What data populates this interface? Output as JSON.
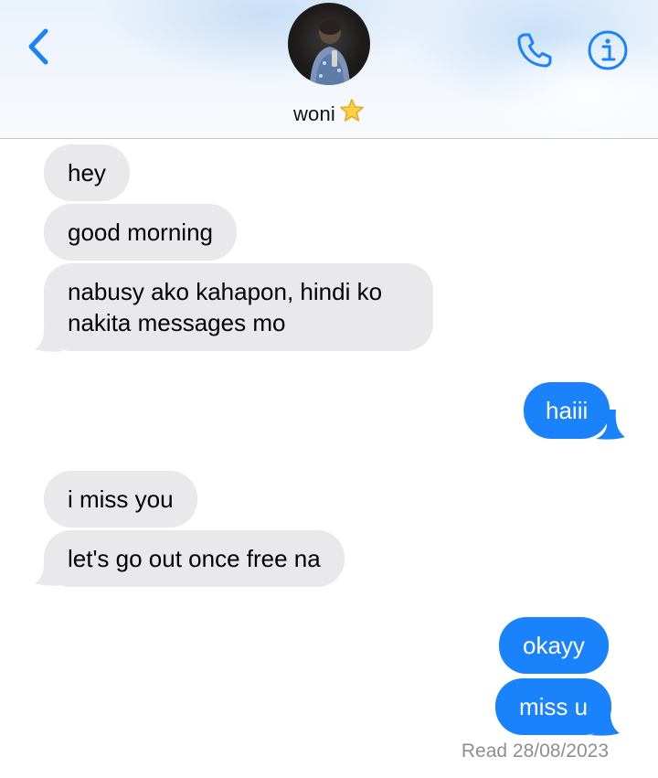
{
  "header": {
    "contact_name": "woni",
    "contact_emoji": "star-emoji-icon"
  },
  "icons": {
    "back": "chevron-left-icon",
    "call": "phone-icon",
    "info": "info-icon"
  },
  "colors": {
    "accent": "#1a82fb",
    "incoming_bubble": "#e9e9eb",
    "outgoing_bubble": "#1a82fb",
    "read_receipt": "#8e8e93"
  },
  "messages": [
    {
      "direction": "incoming",
      "text": "hey"
    },
    {
      "direction": "incoming",
      "text": "good morning"
    },
    {
      "direction": "incoming",
      "lines": [
        "nabusy ako kahapon, hindi ko",
        "nakita messages mo"
      ]
    },
    {
      "direction": "outgoing",
      "text": "haiii"
    },
    {
      "direction": "incoming",
      "text": "i miss you"
    },
    {
      "direction": "incoming",
      "text": "let's go out once free na"
    },
    {
      "direction": "outgoing",
      "text": "okayy"
    },
    {
      "direction": "outgoing",
      "text": "miss u"
    }
  ],
  "read_receipt": "Read 28/08/2023"
}
